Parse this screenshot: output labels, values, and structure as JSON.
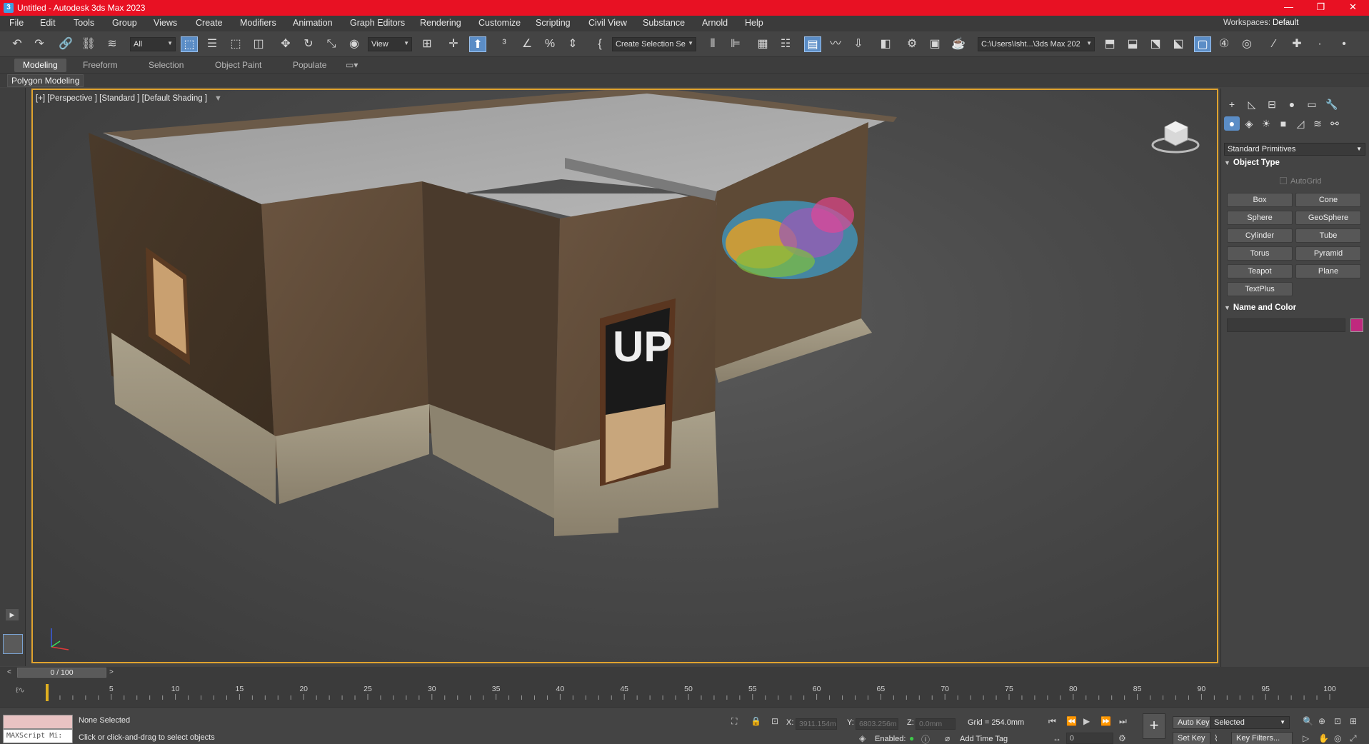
{
  "window": {
    "title": "Untitled - Autodesk 3ds Max 2023",
    "minimize": "—",
    "restore": "❐",
    "close": "✕"
  },
  "menu": {
    "items": [
      "File",
      "Edit",
      "Tools",
      "Group",
      "Views",
      "Create",
      "Modifiers",
      "Animation",
      "Graph Editors",
      "Rendering",
      "Customize",
      "Scripting",
      "Civil View",
      "Substance",
      "Arnold",
      "Help"
    ],
    "workspaces_label": "Workspaces:",
    "workspaces_value": "Default"
  },
  "toolbar": {
    "filter_dropdown": "All",
    "refcoord_dropdown": "View",
    "selection_set_dropdown": "Create Selection Se",
    "project_path": "C:\\Users\\Isht...\\3ds Max 202"
  },
  "ribbon": {
    "tabs": [
      "Modeling",
      "Freeform",
      "Selection",
      "Object Paint",
      "Populate"
    ],
    "active_tab": "Modeling",
    "panel_label": "Polygon Modeling"
  },
  "viewport": {
    "label": "[+] [Perspective ] [Standard ] [Default Shading ]",
    "graffiti_text": "UP"
  },
  "command_panel": {
    "category_dropdown": "Standard Primitives",
    "object_type_title": "Object Type",
    "autogrid_label": "AutoGrid",
    "primitives": [
      "Box",
      "Cone",
      "Sphere",
      "GeoSphere",
      "Cylinder",
      "Tube",
      "Torus",
      "Pyramid",
      "Teapot",
      "Plane",
      "TextPlus"
    ],
    "name_color_title": "Name and Color",
    "object_color": "#c0297e"
  },
  "timeslider": {
    "frame_display": "0 / 100",
    "prev": "<",
    "next": ">"
  },
  "trackbar": {
    "tick_labels": [
      "5",
      "10",
      "15",
      "20",
      "25",
      "30",
      "35",
      "40",
      "45",
      "50",
      "55",
      "60",
      "65",
      "70",
      "75",
      "80",
      "85",
      "90",
      "95",
      "100"
    ]
  },
  "status": {
    "maxscript_label": "MAXScript Mi:",
    "selection_status": "None Selected",
    "prompt": "Click or click-and-drag to select objects",
    "x_label": "X:",
    "x_value": "3911.154m",
    "y_label": "Y:",
    "y_value": "6803.256m",
    "z_label": "Z:",
    "z_value": "0.0mm",
    "grid": "Grid = 254.0mm",
    "enabled_label": "Enabled:",
    "add_time_tag": "Add Time Tag",
    "auto_key": "Auto Key",
    "set_key": "Set Key",
    "selected_dropdown": "Selected",
    "key_filters": "Key Filters...",
    "current_frame": "0"
  },
  "colors": {
    "title_bar": "#e81123",
    "accent": "#5b8dc6",
    "viewport_border": "#e0a32e"
  }
}
